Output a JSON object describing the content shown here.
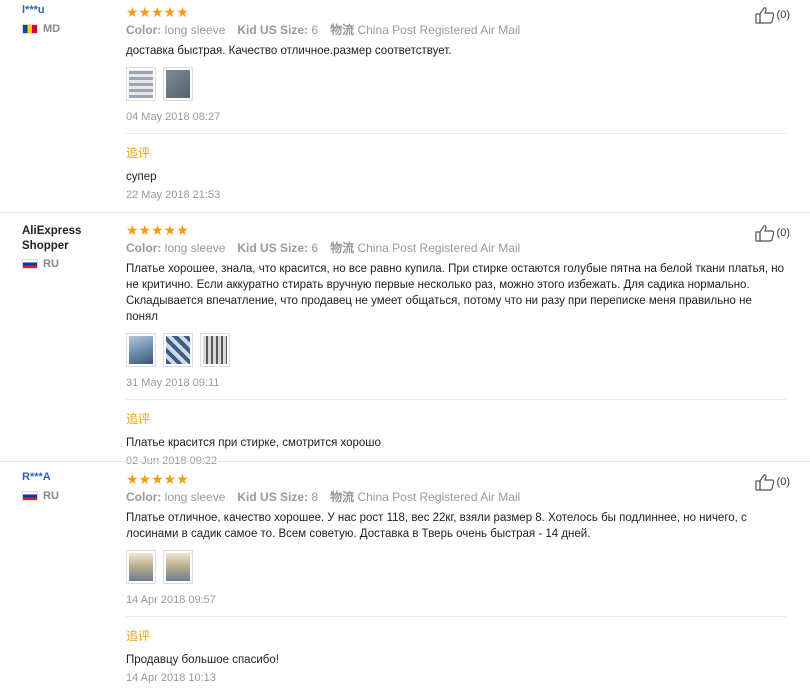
{
  "labels": {
    "color": "Color:",
    "size": "Kid US Size:",
    "shipping": "物流",
    "followup": "追评"
  },
  "colors": {
    "star": "#f29d14",
    "followup": "#f29d14",
    "username": "#2a66b8"
  },
  "reviews": [
    {
      "user": "l***u",
      "country_code": "MD",
      "flag": "moldova-flag",
      "rating": "★★★★★",
      "color": "long sleeve",
      "size": "6",
      "shipping": "China Post Registered Air Mail",
      "text": "доставка быстрая. Качество отличное.размер соответствует.",
      "photos": 2,
      "date": "04 May 2018 08:27",
      "likes": "(0)",
      "followup_text": "супер",
      "followup_date": "22 May 2018 21:53"
    },
    {
      "user": "AliExpress Shopper",
      "country_code": "RU",
      "flag": "russia-flag",
      "rating": "★★★★★",
      "color": "long sleeve",
      "size": "6",
      "shipping": "China Post Registered Air Mail",
      "text_lines": [
        "Платье хорошее, знала, что красится, но все равно купила. При стирке остаются голубые пятна на белой ткани платья, но",
        "не критично. Если аккуратно стирать вручную первые несколько раз, можно этого избежать. Для садика нормально.",
        "Складывается впечатление, что продавец не умеет общаться, потому что ни разу при переписке меня правильно не понял"
      ],
      "photos": 3,
      "date": "31 May 2018 09:11",
      "likes": "(0)",
      "followup_text": "Платье красится при стирке, смотрится хорошо",
      "followup_date": "02 Jun 2018 09:22"
    },
    {
      "user": "R***A",
      "country_code": "RU",
      "flag": "russia-flag",
      "rating": "★★★★★",
      "color": "long sleeve",
      "size": "8",
      "shipping": "China Post Registered Air Mail",
      "text_lines": [
        "Платье отличное, качество хорошее. У нас рост 118, вес 22кг, взяли размер 8. Хотелось бы подлиннее, но ничего, с",
        "лосинами в садик самое то. Всем советую. Доставка в Тверь очень быстрая - 14 дней."
      ],
      "photos": 2,
      "date": "14 Apr 2018 09:57",
      "likes": "(0)",
      "followup_text": "Продавцу большое спасибо!",
      "followup_date": "14 Apr 2018 10:13"
    }
  ]
}
